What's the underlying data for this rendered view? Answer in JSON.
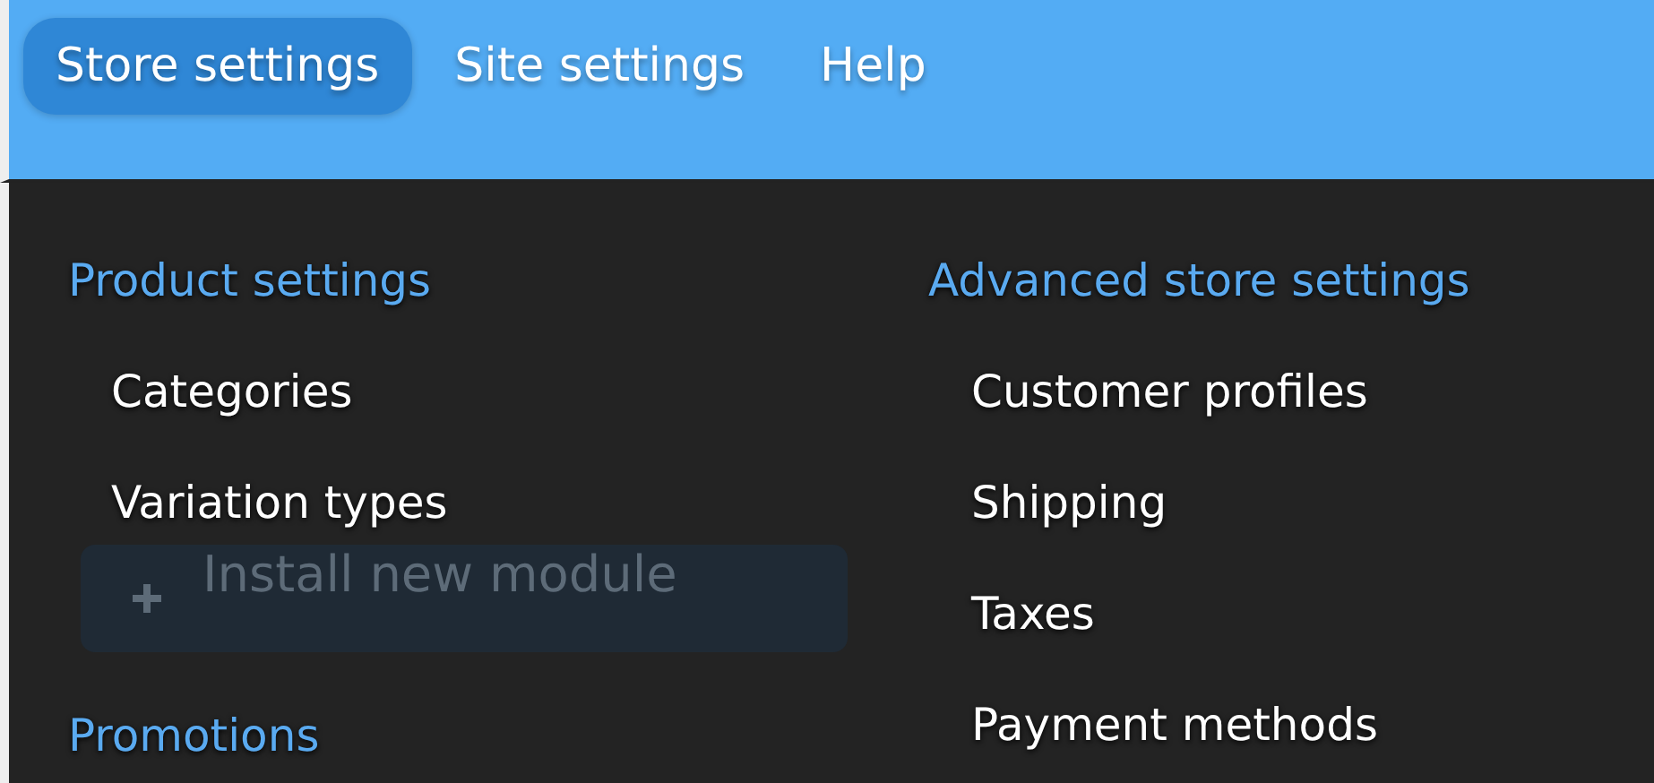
{
  "menu_bar": {
    "items": [
      {
        "label": "Store settings",
        "selected": true
      },
      {
        "label": "Site settings",
        "selected": false
      },
      {
        "label": "Help",
        "selected": false
      }
    ]
  },
  "dropdown": {
    "columns": [
      {
        "sections": [
          {
            "heading": "Product settings",
            "items": [
              "Categories",
              "Variation types"
            ]
          },
          {
            "heading": "Promotions"
          }
        ]
      },
      {
        "sections": [
          {
            "heading": "Advanced store settings",
            "items": [
              "Customer profiles",
              "Shipping",
              "Taxes",
              "Payment methods"
            ]
          }
        ]
      }
    ]
  },
  "background_page": {
    "button": "Install new module"
  }
}
